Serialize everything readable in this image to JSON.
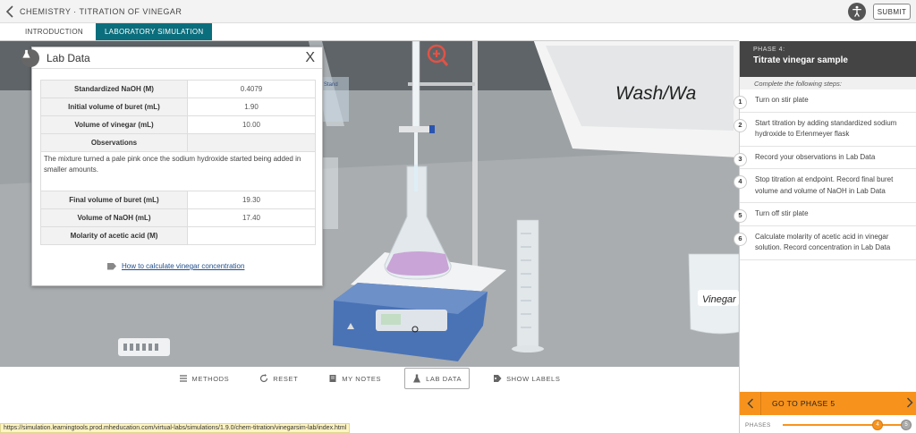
{
  "header": {
    "title": "CHEMISTRY · TITRATION OF VINEGAR",
    "submit_label": "SUBMIT"
  },
  "tabs": [
    {
      "label": "INTRODUCTION",
      "active": false
    },
    {
      "label": "LABORATORY SIMULATION",
      "active": true
    }
  ],
  "scene": {
    "wash_label": "Wash/Wa",
    "vinegar_label": "Vinegar",
    "stand_label": "Stand"
  },
  "lab_data": {
    "title": "Lab Data",
    "close": "X",
    "rows": [
      {
        "label": "Standardized NaOH (M)",
        "value": "0.4079"
      },
      {
        "label": "Initial volume of buret (mL)",
        "value": "1.90"
      },
      {
        "label": "Volume of vinegar (mL)",
        "value": "10.00"
      }
    ],
    "observations_label": "Observations",
    "observations_text": "The mixture turned a pale pink once the sodium hydroxide started being added in smaller amounts.",
    "rows2": [
      {
        "label": "Final volume of buret (mL)",
        "value": "19.30"
      },
      {
        "label": "Volume of NaOH (mL)",
        "value": "17.40"
      },
      {
        "label": "Molarity of acetic acid (M)",
        "value": ""
      }
    ],
    "link_text": "How to calculate vinegar concentration"
  },
  "toolbar": [
    {
      "label": "METHODS",
      "icon": "methods-icon",
      "active": false
    },
    {
      "label": "RESET",
      "icon": "reset-icon",
      "active": false
    },
    {
      "label": "MY NOTES",
      "icon": "notes-icon",
      "active": false
    },
    {
      "label": "LAB DATA",
      "icon": "flask-icon",
      "active": true
    },
    {
      "label": "SHOW LABELS",
      "icon": "tag-icon",
      "active": false
    }
  ],
  "status_url": "https://simulation.learningtools.prod.mheducation.com/virtual-labs/simulations/1.9.0/chem-titration/vinegarsim-lab/index.html",
  "side": {
    "phase_label": "PHASE 4:",
    "phase_title": "Titrate vinegar sample",
    "hint": "Complete the following steps:",
    "steps": [
      {
        "num": "1",
        "text": "Turn on stir plate"
      },
      {
        "num": "2",
        "text": "Start titration by adding standardized sodium hydroxide to Erlenmeyer flask"
      },
      {
        "num": "3",
        "text": "Record your observations in Lab Data"
      },
      {
        "num": "4",
        "text": "Stop titration at endpoint. Record final buret volume and volume of NaOH in Lab Data"
      },
      {
        "num": "5",
        "text": "Turn off stir plate"
      },
      {
        "num": "6",
        "text": "Calculate molarity of acetic acid in vinegar solution. Record concentration in Lab Data"
      }
    ],
    "next_label": "GO TO PHASE 5",
    "phases_label": "PHASES",
    "phase_current": "4",
    "phase_next": "5"
  },
  "colors": {
    "accent_teal": "#0b6e7c",
    "accent_orange": "#f7931d",
    "phase_header": "#444444",
    "solution_pink": "#c9a4d6"
  }
}
